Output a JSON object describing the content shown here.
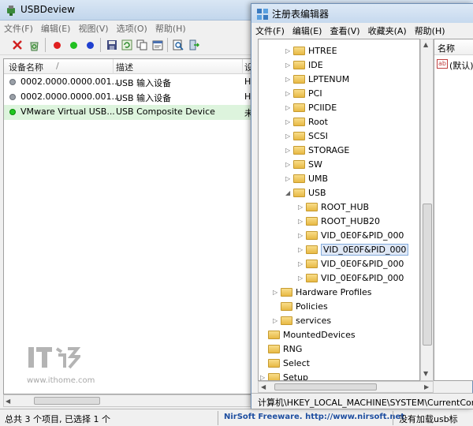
{
  "usbdeview": {
    "title": "USBDeview",
    "menu": [
      "文件(F)",
      "编辑(E)",
      "视图(V)",
      "选项(O)",
      "帮助(H)"
    ],
    "toolbar_icons": [
      "delete-x-icon",
      "recycle-icon",
      "red-dot-icon",
      "green-dot-icon",
      "blue-dot-icon",
      "save-icon",
      "refresh-icon",
      "copy-icon",
      "properties-icon",
      "find-icon",
      "exit-icon"
    ],
    "columns": [
      "设备名称",
      "描述",
      "设"
    ],
    "sort_indicator": "/",
    "rows": [
      {
        "name": "0002.0000.0000.001....",
        "desc": "USB 输入设备",
        "extra": "H",
        "status": "gray"
      },
      {
        "name": "0002.0000.0000.001....",
        "desc": "USB 输入设备",
        "extra": "H",
        "status": "gray"
      },
      {
        "name": "VMware Virtual USB...",
        "desc": "USB Composite Device",
        "extra": "未",
        "status": "green"
      }
    ],
    "status_left": "总共 3 个项目, 已选择 1 个",
    "status_mid": "NirSoft Freeware.  http://www.nirsoft.net",
    "status_right": "没有加载usb标"
  },
  "regedit": {
    "title": "注册表编辑器",
    "menu": [
      "文件(F)",
      "编辑(E)",
      "查看(V)",
      "收藏夹(A)",
      "帮助(H)"
    ],
    "tree": [
      {
        "label": "HTREE",
        "level": 2,
        "expander": "collapsed"
      },
      {
        "label": "IDE",
        "level": 2,
        "expander": "collapsed"
      },
      {
        "label": "LPTENUM",
        "level": 2,
        "expander": "collapsed"
      },
      {
        "label": "PCI",
        "level": 2,
        "expander": "collapsed"
      },
      {
        "label": "PCIIDE",
        "level": 2,
        "expander": "collapsed"
      },
      {
        "label": "Root",
        "level": 2,
        "expander": "collapsed"
      },
      {
        "label": "SCSI",
        "level": 2,
        "expander": "collapsed"
      },
      {
        "label": "STORAGE",
        "level": 2,
        "expander": "collapsed"
      },
      {
        "label": "SW",
        "level": 2,
        "expander": "collapsed"
      },
      {
        "label": "UMB",
        "level": 2,
        "expander": "collapsed"
      },
      {
        "label": "USB",
        "level": 2,
        "expander": "expanded"
      },
      {
        "label": "ROOT_HUB",
        "level": 3,
        "expander": "collapsed"
      },
      {
        "label": "ROOT_HUB20",
        "level": 3,
        "expander": "collapsed"
      },
      {
        "label": "VID_0E0F&PID_000",
        "level": 3,
        "expander": "collapsed"
      },
      {
        "label": "VID_0E0F&PID_000",
        "level": 3,
        "expander": "collapsed",
        "selected": true
      },
      {
        "label": "VID_0E0F&PID_000",
        "level": 3,
        "expander": "collapsed"
      },
      {
        "label": "VID_0E0F&PID_000",
        "level": 3,
        "expander": "collapsed"
      },
      {
        "label": "Hardware Profiles",
        "level": 1,
        "expander": "collapsed"
      },
      {
        "label": "Policies",
        "level": 1,
        "expander": "none"
      },
      {
        "label": "services",
        "level": 1,
        "expander": "collapsed"
      },
      {
        "label": "MountedDevices",
        "level": 0,
        "expander": "none"
      },
      {
        "label": "RNG",
        "level": 0,
        "expander": "none"
      },
      {
        "label": "Select",
        "level": 0,
        "expander": "none"
      },
      {
        "label": "Setup",
        "level": 0,
        "expander": "collapsed"
      }
    ],
    "values_header": "名称",
    "values": [
      {
        "icon": "ab",
        "name": "(默认)"
      }
    ],
    "address": "计算机\\HKEY_LOCAL_MACHINE\\SYSTEM\\CurrentControlSet"
  },
  "watermark": {
    "brand": "IT之家",
    "url": "www.ithome.com"
  },
  "colors": {
    "selection_row": "#ddf4dd",
    "accent_blue": "#1f4fa0",
    "folder": "#e8b944"
  }
}
